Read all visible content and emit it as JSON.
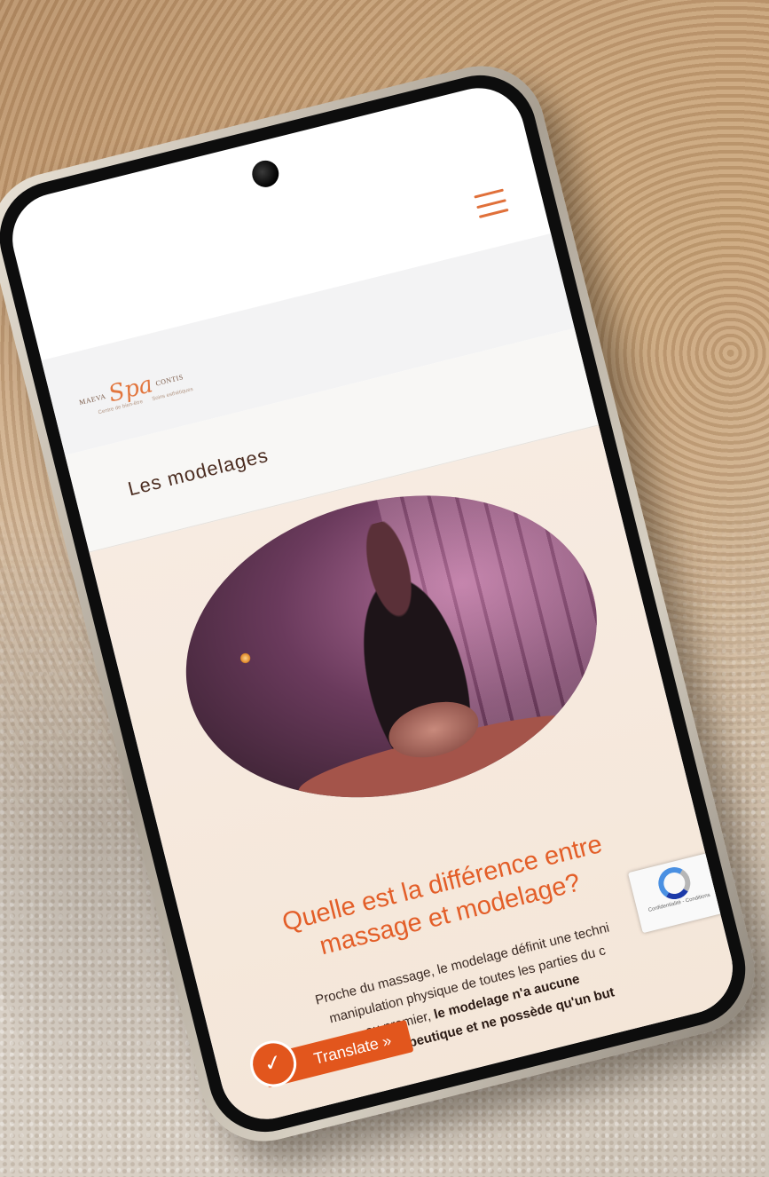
{
  "header": {
    "menu_icon": "hamburger-menu-icon"
  },
  "logo": {
    "left": "MAEVA",
    "mark": "Spa",
    "right": "CONTIS",
    "sub_left": "Centre de bien-être",
    "sub_right": "Soins esthétiques"
  },
  "page": {
    "title": "Les modelages"
  },
  "section": {
    "heading_line1": "Quelle est la différence entre",
    "heading_line2": "massage et modelage?",
    "body_line1": "Proche du massage, le modelage définit une techni",
    "body_line2": "manipulation physique de toutes les parties du c",
    "body_line3_a": "au premier, ",
    "body_line3_b": "le modelage n'a aucune",
    "body_line4": "visée thérapeutique et ne possède qu'un but"
  },
  "recaptcha": {
    "text": "Confidentialité - Conditions",
    "icon": "recaptcha-icon"
  },
  "translate": {
    "label": "Translate »",
    "icon": "translate-icon"
  },
  "colors": {
    "accent": "#e35e28",
    "title": "#4b2c20",
    "translate_bg": "#e2561d"
  }
}
